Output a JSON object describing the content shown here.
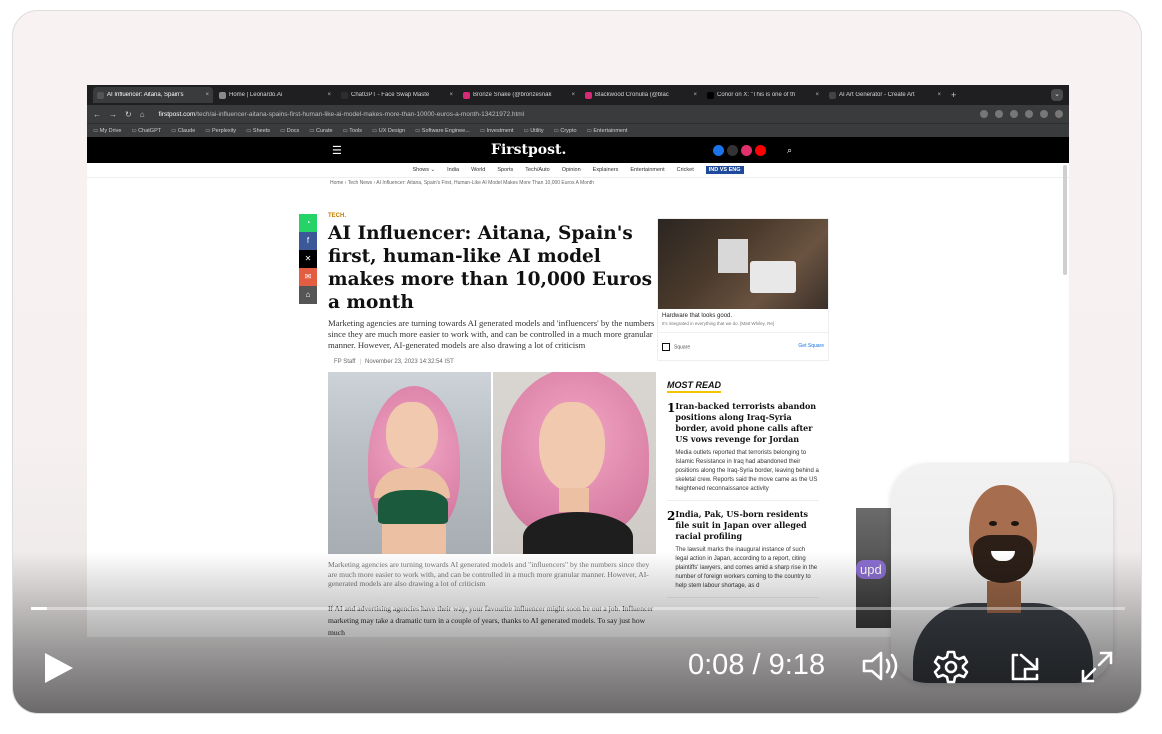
{
  "browser": {
    "tabs": [
      {
        "label": "AI Influencer: Aitana, Spain's",
        "color": "#555555",
        "active": true
      },
      {
        "label": "Home | Leonardo.Ai",
        "color": "#8a8a8a",
        "active": false
      },
      {
        "label": "ChatGPT - Face Swap Maste",
        "color": "#2d2d2d",
        "active": false
      },
      {
        "label": "Bronze Snake (@bronzesnak",
        "color": "#d62976",
        "active": false
      },
      {
        "label": "Blackwood Cronulla (@blac",
        "color": "#d62976",
        "active": false
      },
      {
        "label": "Conor on X: \"This is one of th",
        "color": "#000000",
        "active": false
      },
      {
        "label": "AI Art Generator - Create Art",
        "color": "#444444",
        "active": false
      }
    ],
    "new_tab": "+",
    "close_glyph": "×",
    "url_host": "firstpost.com",
    "url_path": "/tech/ai-influencer-aitana-spains-first-human-like-ai-model-makes-more-than-10000-euros-a-month-13421972.html",
    "bookmarks": [
      "My Drive",
      "ChatGPT",
      "Claude",
      "Perplexity",
      "Sheets",
      "Docs",
      "Curate",
      "Tools",
      "UX Design",
      "Software Enginee...",
      "Investment",
      "Utility",
      "Crypto",
      "Entertainment"
    ]
  },
  "site": {
    "logo": "Firstpost.",
    "nav": [
      "Shows ⌄",
      "India",
      "World",
      "Sports",
      "Tech/Auto",
      "Opinion",
      "Explainers",
      "Entertainment",
      "Cricket"
    ],
    "nav_pill": "IND VS ENG",
    "breadcrumb": "Home  ›  Tech News  ›  AI Influencer: Aitana, Spain's First, Human-Like AI Model Makes More Than 10,000 Euros A Month",
    "social_colors": [
      "#1a73e8",
      "#333333",
      "#e1306c",
      "#ff0000"
    ]
  },
  "article": {
    "tag": "TECH.",
    "headline": "AI Influencer: Aitana, Spain's first, human-like AI model makes more than 10,000 Euros a month",
    "dek": "Marketing agencies are turning towards AI generated models and 'influencers' by the numbers since they are much more easier to work with, and can be controlled in a much more granular manner. However, AI-generated models are also drawing a lot of criticism",
    "author": "FP Staff",
    "date": "November 23, 2023 14:32:54 IST",
    "caption": "Marketing agencies are turning towards AI generated models and \"influencers\" by the numbers since they are much more easier to work with, and can be controlled in a much more granular manner. However, AI-generated models are also drawing a lot of criticism",
    "body": "If AI and advertising agencies have their way, your favourite influencer might soon be out a job. Influencer marketing may take a dramatic turn in a couple of years, thanks to AI generated models. To say just how much"
  },
  "ad": {
    "title": "Hardware that looks good.",
    "subtitle": "It's integrated in everything that we do. [Matt Whiley, Re]",
    "brand": "Square",
    "cta": "Get Square"
  },
  "most_read": {
    "title": "MOST READ",
    "items": [
      {
        "num": "1",
        "headline": "Iran-backed terrorists abandon positions along Iraq-Syria border, avoid phone calls after US vows revenge for Jordan",
        "body": "Media outlets reported that terrorists belonging to Islamic Resistance in Iraq had abandoned their positions along the Iraq-Syria border, leaving behind a skeletal crew. Reports said the move came as the US heightened reconnaissance activity"
      },
      {
        "num": "2",
        "headline": "India, Pak, US-born residents file suit in Japan over alleged racial profiling",
        "body": "The lawsuit marks the inaugural instance of such legal action in Japan, according to a report, citing plaintiffs' lawyers, and comes amid a sharp rise in the number of foreign workers coming to the country to help stem labour shortage, as d"
      }
    ]
  },
  "peek_label": "upd",
  "player": {
    "current_time": "0:08",
    "duration": "9:18",
    "time_sep": " / ",
    "progress_fraction": 0.0143
  }
}
